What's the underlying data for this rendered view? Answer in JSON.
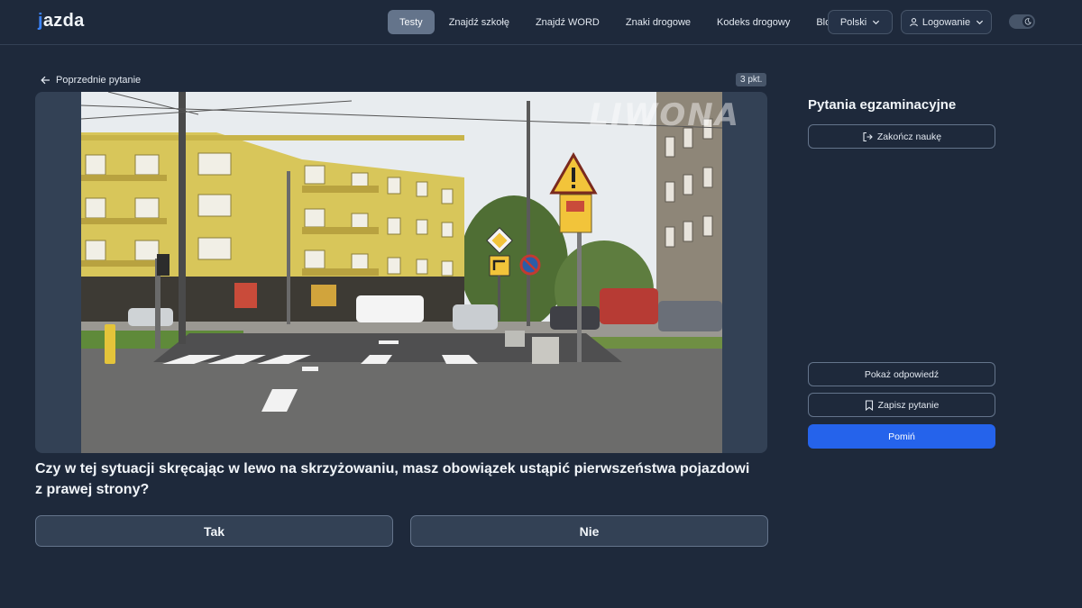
{
  "header": {
    "logo": "jazda",
    "nav": [
      {
        "label": "Testy",
        "active": true
      },
      {
        "label": "Znajdź szkołę",
        "active": false
      },
      {
        "label": "Znajdź WORD",
        "active": false
      },
      {
        "label": "Znaki drogowe",
        "active": false
      },
      {
        "label": "Kodeks drogowy",
        "active": false
      },
      {
        "label": "Blog",
        "active": false
      }
    ],
    "language": "Polski",
    "login": "Logowanie",
    "theme_toggle_icon": "moon-icon"
  },
  "main": {
    "back_label": "Poprzednie pytanie",
    "points": "3 pkt.",
    "media_watermark": "LIWONA",
    "question": "Czy w tej sytuacji skręcając w lewo na skrzyżowaniu, masz obowiązek ustąpić pierwszeństwa pojazdowi z prawej strony?",
    "answers": [
      "Tak",
      "Nie"
    ]
  },
  "sidebar": {
    "title": "Pytania egzaminacyjne",
    "finish_label": "Zakończ naukę",
    "show_answer_label": "Pokaż odpowiedź",
    "save_label": "Zapisz pytanie",
    "skip_label": "Pomiń"
  },
  "colors": {
    "background": "#1e293b",
    "accent": "#2563eb",
    "logo_accent": "#3b82f6"
  }
}
